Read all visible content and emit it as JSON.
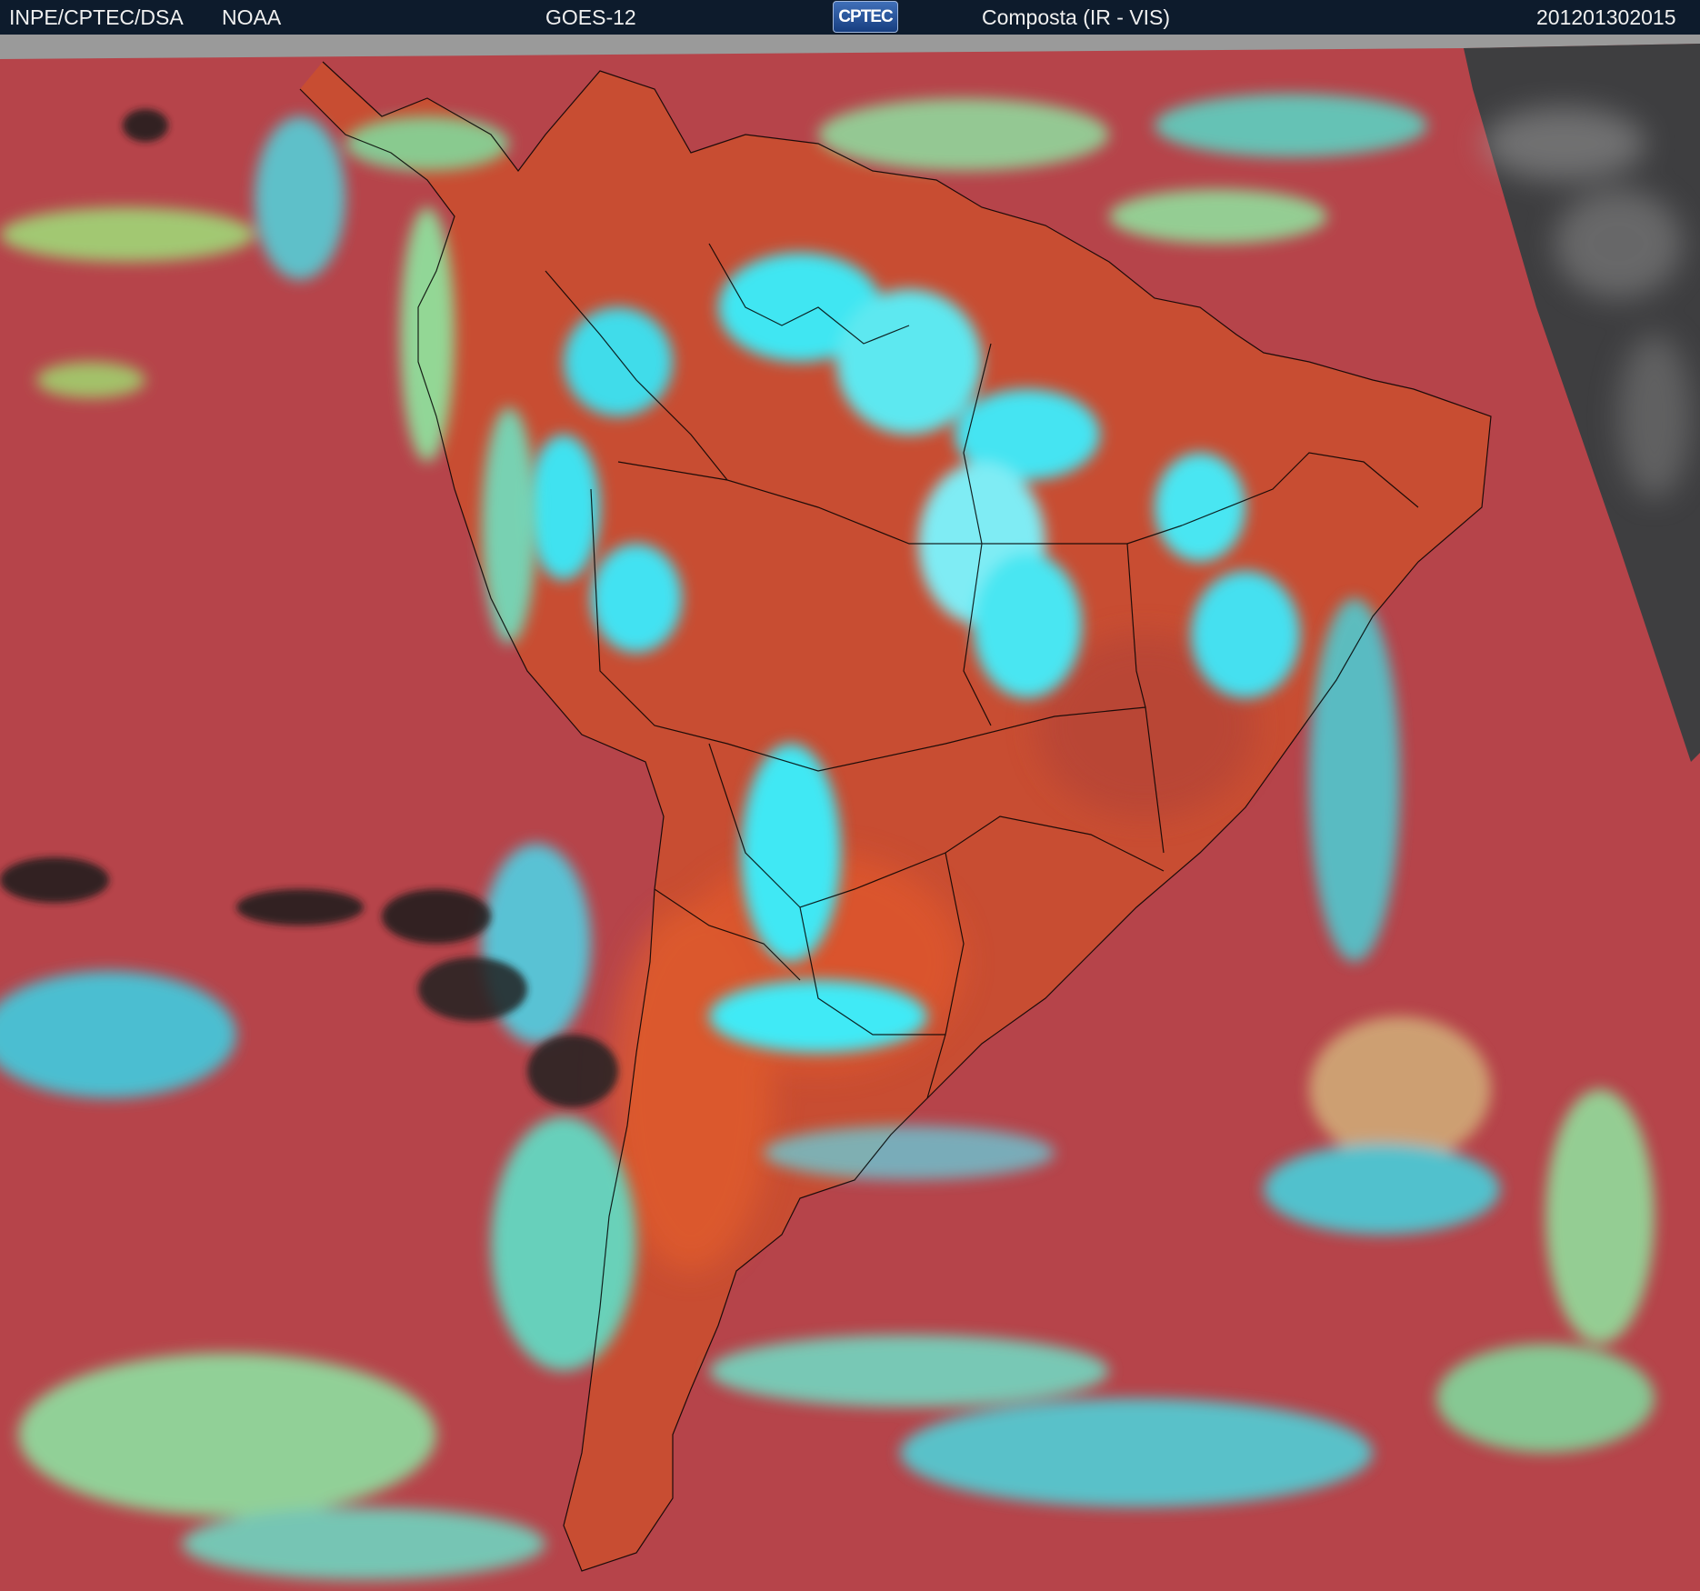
{
  "header": {
    "agency": "INPE/CPTEC/DSA",
    "provider": "NOAA",
    "satellite": "GOES-12",
    "logo_text": "CPTEC",
    "product": "Composta (IR - VIS)",
    "timestamp": "201201302015"
  },
  "colors": {
    "header_bg": "#0d1b2c",
    "ocean_red": "#b6444a",
    "land_orange": "#c84d32",
    "cloud_cyan": "#3fe6f2",
    "cloud_green": "#7fe89a",
    "cold_black": "#1c1c1c",
    "night_gray": "#4a4a4a",
    "coastline": "#000000"
  }
}
